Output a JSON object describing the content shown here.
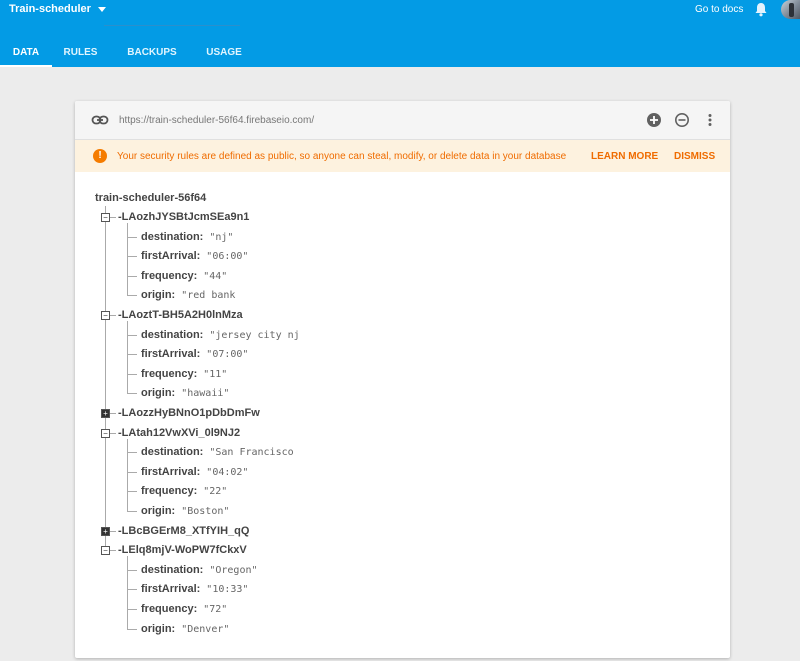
{
  "topbar": {
    "project_name": "Train-scheduler",
    "docs_label": "Go to docs"
  },
  "tabs": [
    {
      "label": "DATA",
      "active": true
    },
    {
      "label": "RULES",
      "active": false
    },
    {
      "label": "BACKUPS",
      "active": false
    },
    {
      "label": "USAGE",
      "active": false
    }
  ],
  "database": {
    "url": "https://train-scheduler-56f64.firebaseio.com/"
  },
  "warning": {
    "icon": "!",
    "text": "Your security rules are defined as public, so anyone can steal, modify, or delete data in your database",
    "learn_more": "LEARN MORE",
    "dismiss": "DISMISS"
  },
  "tree": {
    "root": "train-scheduler-56f64",
    "nodes": [
      {
        "key": "-LAozhJYSBtJcmSEa9n1",
        "expanded": true,
        "toggle": "−",
        "children": [
          {
            "key": "destination:",
            "value": "\"nj\""
          },
          {
            "key": "firstArrival:",
            "value": "\"06:00\""
          },
          {
            "key": "frequency:",
            "value": "\"44\""
          },
          {
            "key": "origin:",
            "value": "\"red bank"
          }
        ]
      },
      {
        "key": "-LAoztT-BH5A2H0lnMza",
        "expanded": true,
        "toggle": "−",
        "children": [
          {
            "key": "destination:",
            "value": "\"jersey city nj"
          },
          {
            "key": "firstArrival:",
            "value": "\"07:00\""
          },
          {
            "key": "frequency:",
            "value": "\"11\""
          },
          {
            "key": "origin:",
            "value": "\"hawaii\""
          }
        ]
      },
      {
        "key": "-LAozzHyBNnO1pDbDmFw",
        "expanded": false,
        "toggle": "+",
        "children": []
      },
      {
        "key": "-LAtah12VwXVi_0l9NJ2",
        "expanded": true,
        "toggle": "−",
        "children": [
          {
            "key": "destination:",
            "value": "\"San Francisco"
          },
          {
            "key": "firstArrival:",
            "value": "\"04:02\""
          },
          {
            "key": "frequency:",
            "value": "\"22\""
          },
          {
            "key": "origin:",
            "value": "\"Boston\""
          }
        ]
      },
      {
        "key": "-LBcBGErM8_XTfYIH_qQ",
        "expanded": false,
        "toggle": "+",
        "children": []
      },
      {
        "key": "-LElq8mjV-WoPW7fCkxV",
        "expanded": true,
        "toggle": "−",
        "children": [
          {
            "key": "destination:",
            "value": "\"Oregon\""
          },
          {
            "key": "firstArrival:",
            "value": "\"10:33\""
          },
          {
            "key": "frequency:",
            "value": "\"72\""
          },
          {
            "key": "origin:",
            "value": "\"Denver\""
          }
        ]
      }
    ]
  },
  "colors": {
    "header": "#039be5",
    "warning_bg": "#fdf2df",
    "warning_text": "#ef6c00"
  }
}
